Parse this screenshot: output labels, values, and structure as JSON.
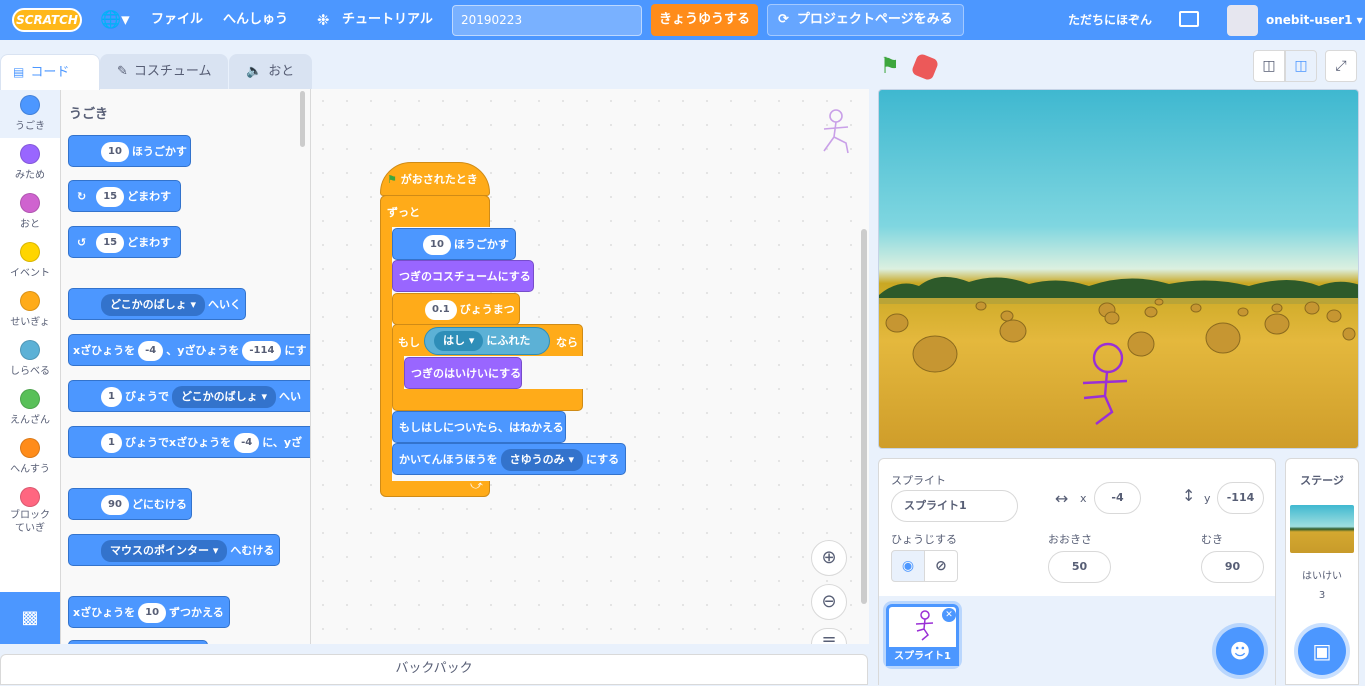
{
  "menubar": {
    "logo": "SCRATCH",
    "language_icon": "globe-icon",
    "file": "ファイル",
    "edit": "へんしゅう",
    "tutorial": "チュートリアル",
    "project_title": "20190223",
    "share": "きょうゆうする",
    "see_project_page": "プロジェクトページをみる",
    "my_stuff": "ただちにほぞん",
    "username": "onebit-user1"
  },
  "tabs": {
    "code": "コード",
    "costumes": "コスチューム",
    "sounds": "おと"
  },
  "categories": [
    {
      "label": "うごき",
      "color": "#4c97ff"
    },
    {
      "label": "みため",
      "color": "#9966ff"
    },
    {
      "label": "おと",
      "color": "#cf63cf"
    },
    {
      "label": "イベント",
      "color": "#ffd500"
    },
    {
      "label": "せいぎょ",
      "color": "#ffab19"
    },
    {
      "label": "しらべる",
      "color": "#5cb1d6"
    },
    {
      "label": "えんざん",
      "color": "#59c059"
    },
    {
      "label": "へんすう",
      "color": "#ff8c1a"
    },
    {
      "label": "ブロックていぎ",
      "color": "#ff6680"
    }
  ],
  "palette": {
    "heading": "うごき",
    "move_steps": "10",
    "move_label": "ほうごかす",
    "turn_right_deg": "15",
    "turn_right_label": "どまわす",
    "turn_left_deg": "15",
    "turn_left_label": "どまわす",
    "goto_target": "どこかのばしょ",
    "goto_label": "へいく",
    "gotoxy_x_label": "xざひょうを",
    "gotoxy_x": "-4",
    "gotoxy_y_label": "、yざひょうを",
    "gotoxy_y": "-114",
    "gotoxy_tail": "にす",
    "glide_secs": "1",
    "glide_label": "びょうで",
    "glide_target": "どこかのばしょ",
    "glide_tail": "へい",
    "glidexy_secs": "1",
    "glidexy_label": "びょうでxざひょうを",
    "glidexy_x": "-4",
    "glidexy_tail": "に、yざ",
    "point_dir": "90",
    "point_label": "どにむける",
    "pointto_target": "マウスのポインター",
    "pointto_label": "へむける",
    "changex_label": "xざひょうを",
    "changex_val": "10",
    "changex_tail": "ずつかえる"
  },
  "script": {
    "hat": "がおされたとき",
    "forever": "ずっと",
    "move_steps": "10",
    "move_label": "ほうごかす",
    "next_costume": "つぎのコスチュームにする",
    "wait_secs": "0.1",
    "wait_label": "びょうまつ",
    "if_label": "もし",
    "touching_target": "はし",
    "touching_label": "にふれた",
    "then_label": "なら",
    "next_backdrop": "つぎのはいけいにする",
    "bounce": "もしはしについたら、はねかえる",
    "rotation_label": "かいてんほうほうを",
    "rotation_style": "さゆうのみ",
    "rotation_tail": "にする"
  },
  "backpack": "バックパック",
  "sprite_info": {
    "sprite_label": "スプライト",
    "sprite_name": "スプライト1",
    "x_label": "x",
    "x": "-4",
    "y_label": "y",
    "y": "-114",
    "show_label": "ひょうじする",
    "size_label": "おおきさ",
    "size": "50",
    "direction_label": "むき",
    "direction": "90",
    "thumb_name": "スプライト1"
  },
  "stage_panel": {
    "title": "ステージ",
    "backdrops_label": "はいけい",
    "backdrops_count": "3"
  }
}
